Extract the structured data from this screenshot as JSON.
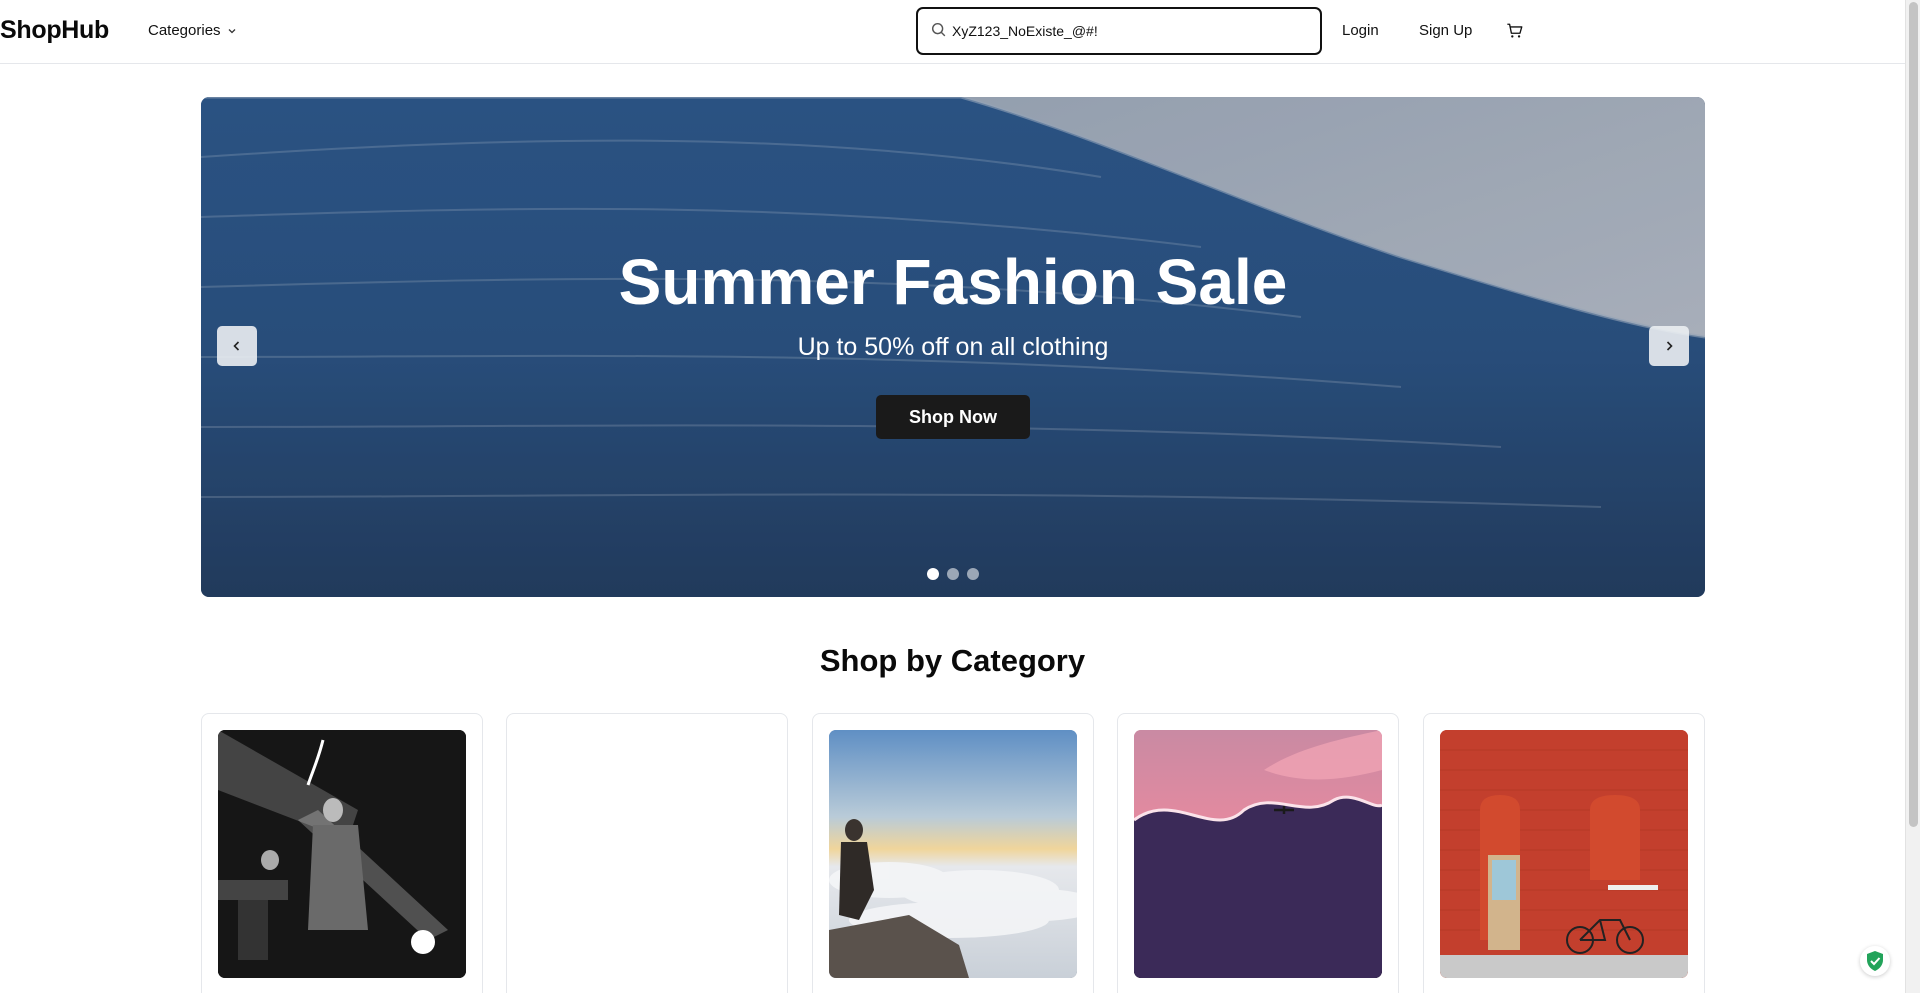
{
  "header": {
    "logo": "ShopHub",
    "categories_label": "Categories",
    "search_value": "XyZ123_NoExiste_@#!",
    "login_label": "Login",
    "signup_label": "Sign Up"
  },
  "hero": {
    "title": "Summer Fashion Sale",
    "subtitle": "Up to 50% off on all clothing",
    "cta_label": "Shop Now",
    "slide_count": 3,
    "active_slide": 1
  },
  "categories_section": {
    "title": "Shop by Category"
  },
  "icons": {
    "search": "search-icon",
    "chevron": "chevron-down-icon",
    "cart": "cart-icon",
    "prev": "chevron-left-icon",
    "next": "chevron-right-icon",
    "shield": "shield-check-icon"
  },
  "colors": {
    "accent": "#111111",
    "cta_bg": "#1a1a1a",
    "shield_green": "#22a35a"
  }
}
